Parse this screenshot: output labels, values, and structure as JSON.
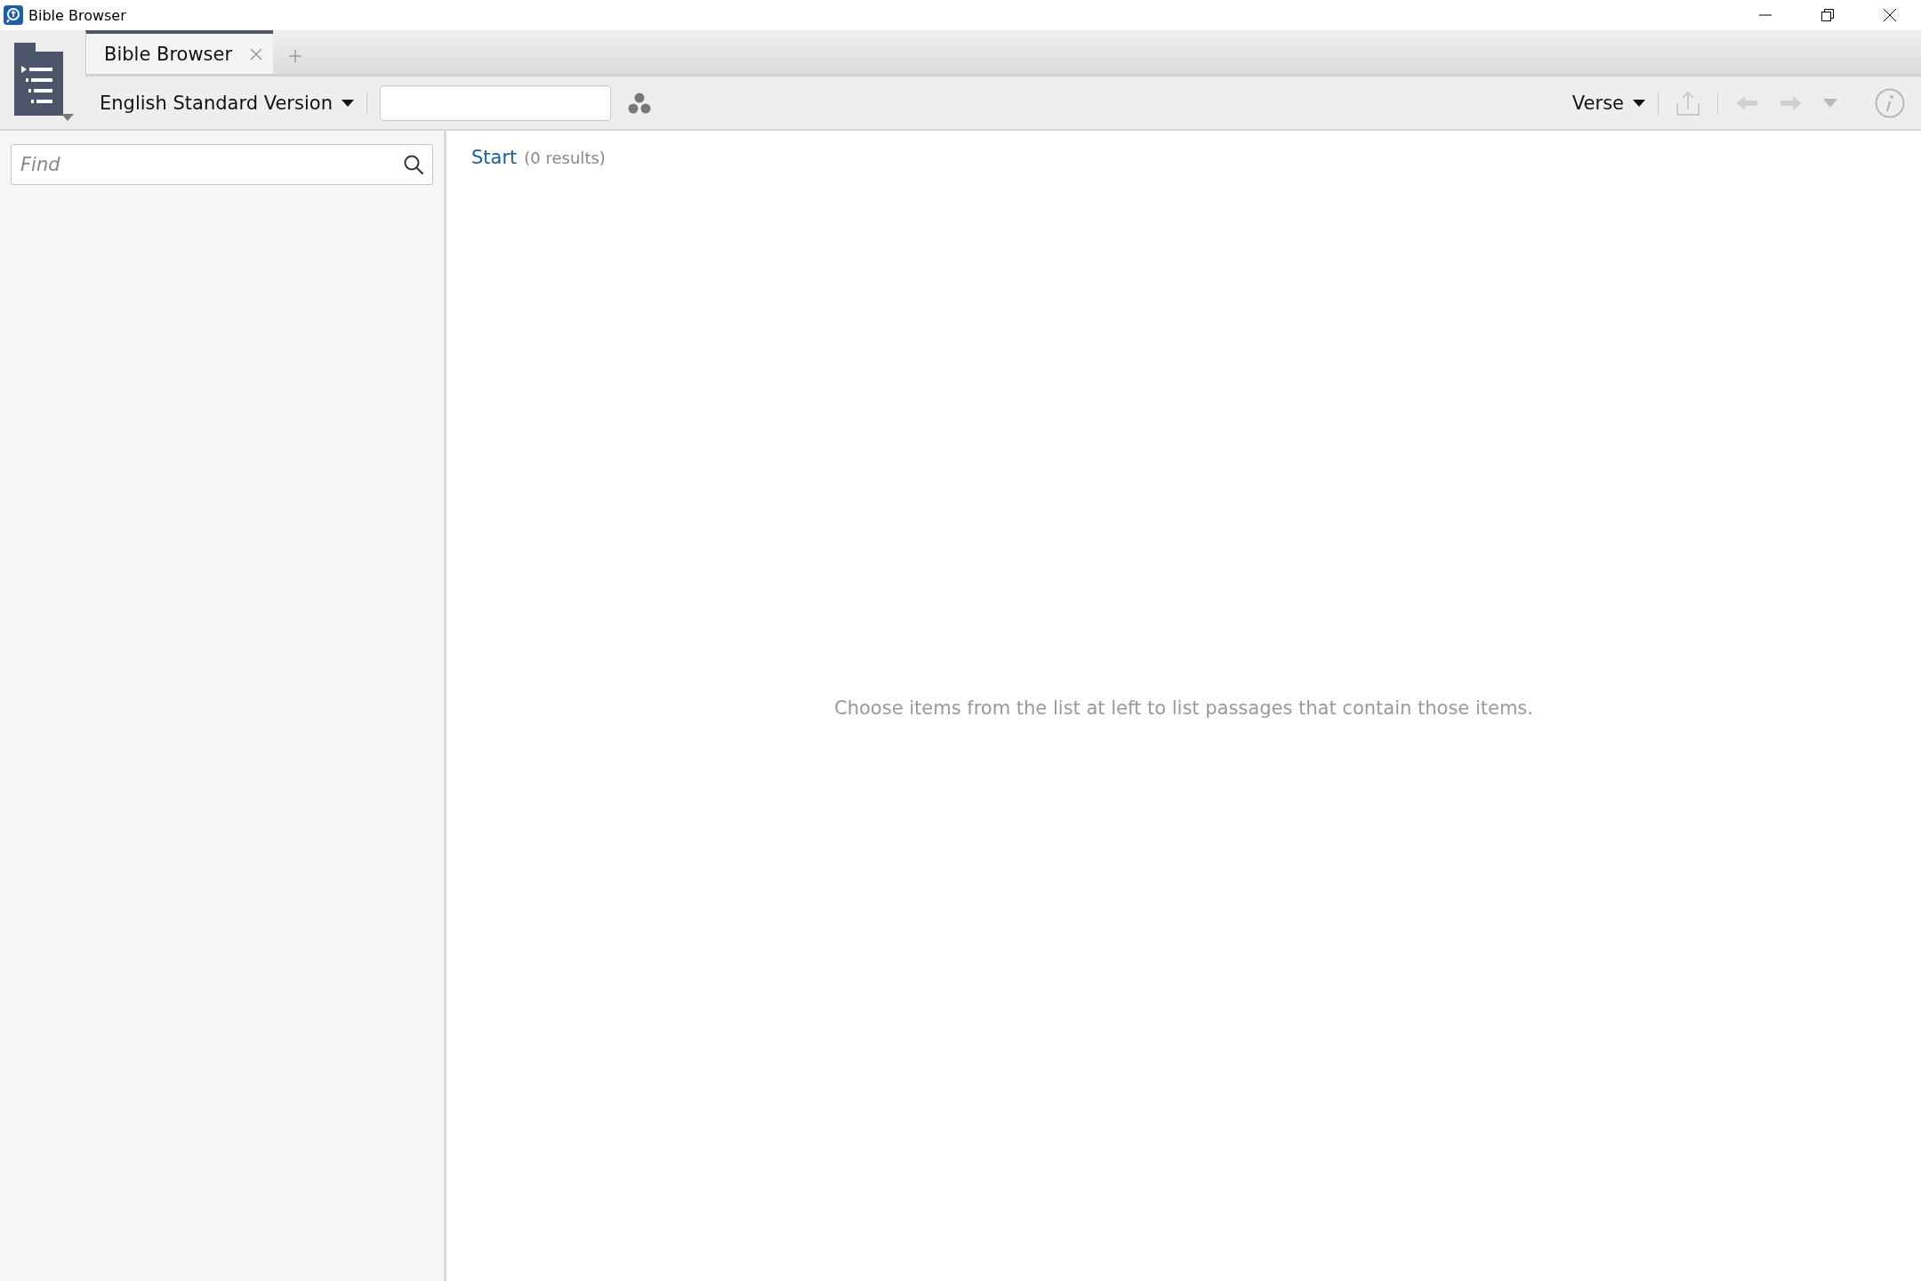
{
  "window": {
    "title": "Bible Browser"
  },
  "tabs": [
    {
      "label": "Bible Browser",
      "selected": true
    }
  ],
  "toolbar": {
    "version": "English Standard Version",
    "mode": "Verse",
    "share": {
      "disabled": true
    },
    "back": {
      "disabled": true
    },
    "forward": {
      "disabled": true
    },
    "history": {
      "disabled": true
    },
    "info": {
      "disabled": true
    }
  },
  "sidebar": {
    "find": {
      "placeholder": "Find"
    }
  },
  "content": {
    "link": "Start",
    "count": "(0 results)",
    "message": "Choose items from the list at left to list passages that contain those items."
  }
}
